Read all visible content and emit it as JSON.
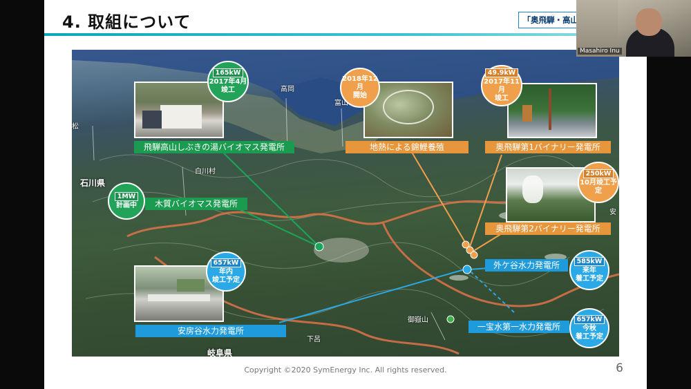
{
  "slide": {
    "title": "4. 取組について",
    "banner": "「奥飛騨・高山自然エネルギーの",
    "footer": "Copyright ©2020 SymEnergy Inc. All rights reserved.",
    "page_number": "6"
  },
  "video": {
    "participant_name": "Masahiro Inu"
  },
  "places": {
    "takaoka": "高岡",
    "toyama": "富山",
    "shirakawa": "白川村",
    "matsu": "松",
    "ishikawa": "石川県",
    "gifu": "岐阜県",
    "ontake": "御嶽山",
    "shimoro": "下呂",
    "an": "安"
  },
  "sites": [
    {
      "label": "飛騨高山しぶきの湯バイオマス発電所",
      "badge": [
        "165kW",
        "2017年4月",
        "竣工"
      ],
      "color": "green"
    },
    {
      "label": "木質バイオマス発電所",
      "badge": [
        "1MW",
        "計画中"
      ],
      "color": "green"
    },
    {
      "label": "地熱による錦鯉養殖",
      "badge": [
        "2018年12月",
        "開始"
      ],
      "color": "orange"
    },
    {
      "label": "奥飛騨第1バイナリー発電所",
      "badge": [
        "49.9kW",
        "2017年11月",
        "竣工"
      ],
      "color": "orange"
    },
    {
      "label": "奥飛騨第2バイナリー発電所",
      "badge": [
        "250kW",
        "10月竣工予定"
      ],
      "color": "orange"
    },
    {
      "label": "安房谷水力発電所",
      "badge": [
        "657kW",
        "年内",
        "竣工予定"
      ],
      "color": "blue"
    },
    {
      "label": "外ケ谷水力発電所",
      "badge": [
        "585kW",
        "来年",
        "着工予定"
      ],
      "color": "blue"
    },
    {
      "label": "一宝水第一水力発電所",
      "badge": [
        "657kW",
        "今秋",
        "着工予定"
      ],
      "color": "blue"
    }
  ],
  "colors": {
    "green": "#1a9b4f",
    "orange": "#e7963b",
    "blue": "#1f9bdc",
    "accent": "#0aa8b8"
  }
}
